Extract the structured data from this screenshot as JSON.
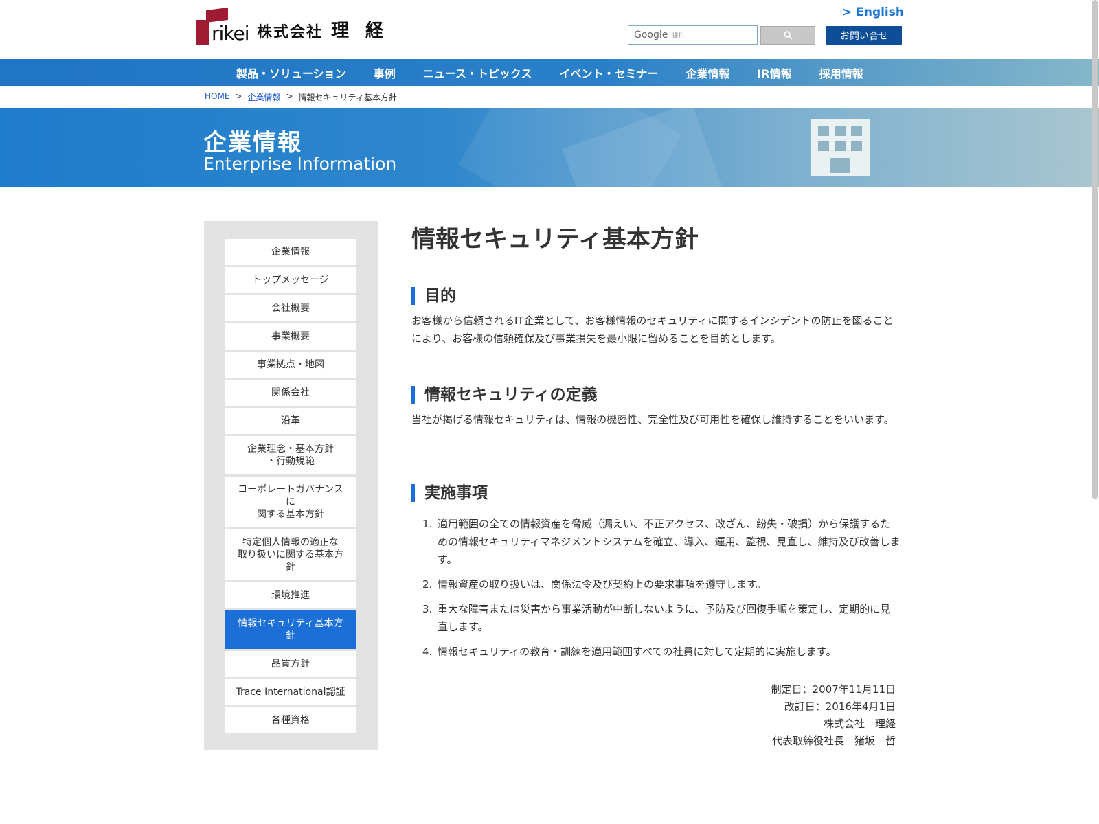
{
  "header": {
    "logo_word": "rikei",
    "logo_company_prefix": "株式会社",
    "logo_company_name": "理経",
    "english_link": "> English",
    "search_provider": "Google",
    "search_provider_suffix": "提供",
    "search_button_icon": "search-icon",
    "contact_button": "お問い合せ"
  },
  "nav": {
    "items": [
      "製品・ソリューション",
      "事例",
      "ニュース・トピックス",
      "イベント・セミナー",
      "企業情報",
      "IR情報",
      "採用情報"
    ]
  },
  "breadcrumb": {
    "items": [
      "HOME",
      "企業情報",
      "情報セキュリティ基本方針"
    ],
    "separator": ">"
  },
  "hero": {
    "title": "企業情報",
    "subtitle": "Enterprise Information",
    "icon": "building-icon"
  },
  "sidebar": {
    "items": [
      "企業情報",
      "トップメッセージ",
      "会社概要",
      "事業概要",
      "事業拠点・地図",
      "関係会社",
      "沿革",
      "企業理念・基本方針\n・行動規範",
      "コーポレートガバナンス\nに\n関する基本方針",
      "特定個人情報の適正な\n取り扱いに関する基本方\n針",
      "環境推進",
      "情報セキュリティ基本方\n針",
      "品質方針",
      "Trace International認証",
      "各種資格"
    ],
    "active_index": 11
  },
  "main": {
    "title": "情報セキュリティ基本方針",
    "sections": [
      {
        "heading": "目的",
        "body": "お客様から信頼されるIT企業として、お客様情報のセキュリティに関するインシデントの防止を図ることにより、お客様の信頼確保及び事業損失を最小限に留めることを目的とします。"
      },
      {
        "heading": "情報セキュリティの定義",
        "body": "当社が掲げる情報セキュリティは、情報の機密性、完全性及び可用性を確保し維持することをいいます。"
      },
      {
        "heading": "実施事項",
        "list": [
          "適用範囲の全ての情報資産を脅威（漏えい、不正アクセス、改ざん、紛失・破損）から保護するための情報セキュリティマネジメントシステムを確立、導入、運用、監視、見直し、維持及び改善します。",
          "情報資産の取り扱いは、関係法令及び契約上の要求事項を遵守します。",
          "重大な障害または災害から事業活動が中断しないように、予防及び回復手順を策定し、定期的に見直します。",
          "情報セキュリティの教育・訓練を適用範囲すべての社員に対して定期的に実施します。"
        ]
      }
    ],
    "signature": {
      "established": "制定日：2007年11月11日",
      "revised": "改訂日：2016年4月1日",
      "company": "株式会社　理経",
      "president": "代表取締役社長　猪坂　哲"
    }
  },
  "colors": {
    "nav_blue": "#2075c4",
    "accent_blue": "#1d6fd8",
    "contact_navy": "#0e4d97",
    "logo_red": "#9e1b32",
    "sidebar_bg": "#e3e3e3"
  }
}
